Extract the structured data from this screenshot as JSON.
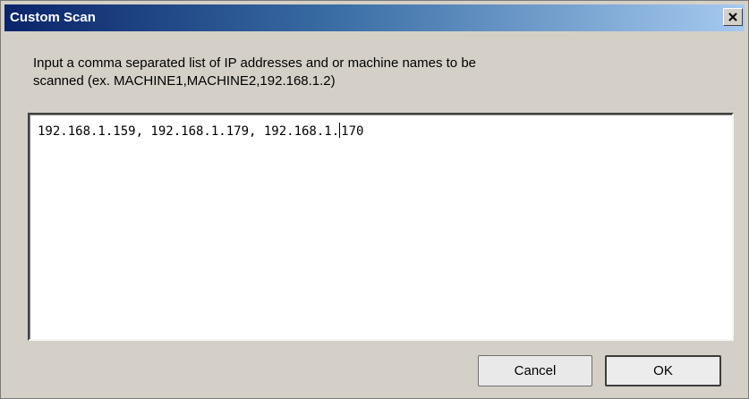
{
  "window": {
    "title": "Custom Scan",
    "close_icon": "close-icon"
  },
  "instructions": {
    "line1": "Input a comma separated list of IP addresses and or machine names to be",
    "line2": "scanned (ex. MACHINE1,MACHINE2,192.168.1.2)"
  },
  "input": {
    "value_before_caret": "192.168.1.159, 192.168.1.179, 192.168.1.",
    "value_after_caret": "170"
  },
  "buttons": {
    "cancel_label": "Cancel",
    "ok_label": "OK"
  },
  "colors": {
    "title_gradient_start": "#0a246a",
    "title_gradient_end": "#a6caf0",
    "dialog_background": "#d4d0c8"
  }
}
